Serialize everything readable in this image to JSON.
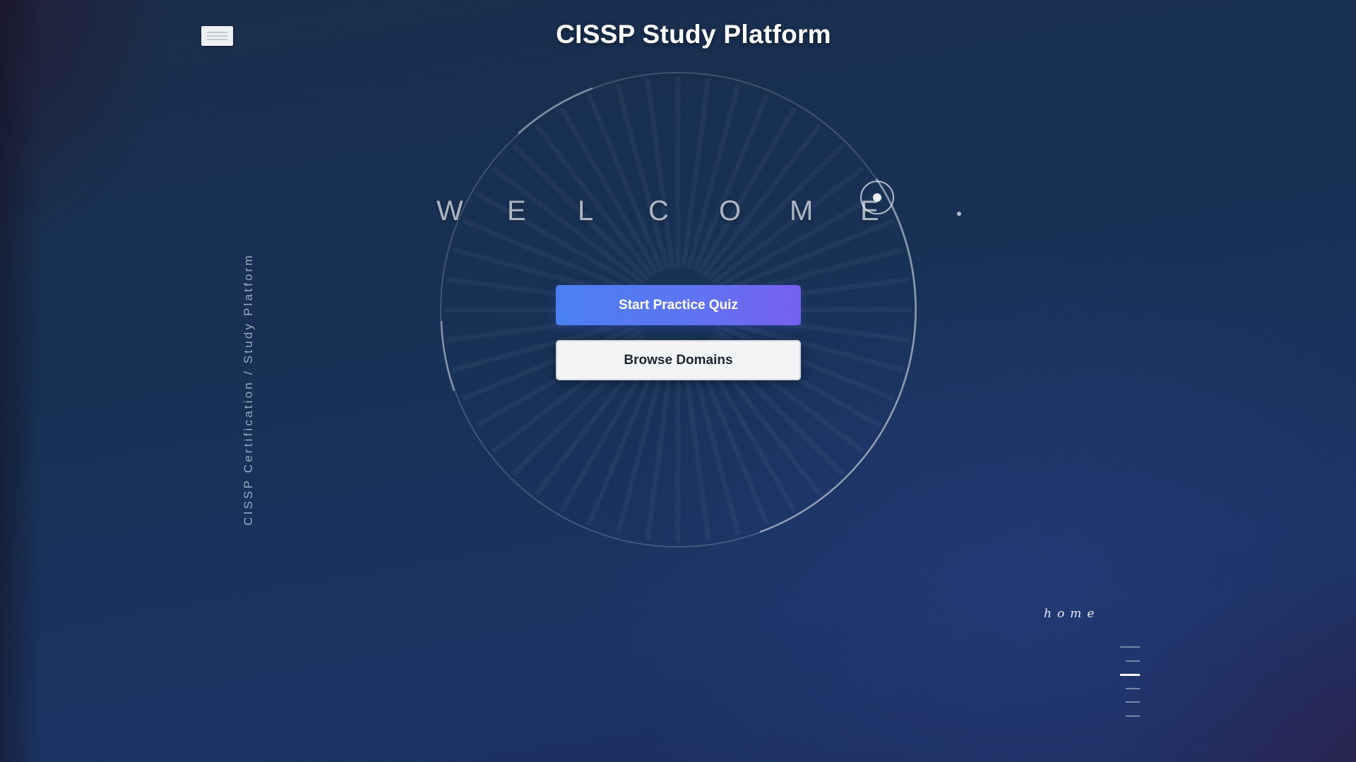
{
  "header": {
    "title": "CISSP Study Platform"
  },
  "sidebar": {
    "caption": "CISSP Certification / Study Platform"
  },
  "hero": {
    "welcome_letters": [
      "W",
      "E",
      "L",
      "C",
      "O",
      "M",
      "E"
    ],
    "primary_button": "Start Practice Quiz",
    "secondary_button": "Browse Domains"
  },
  "section_indicator": {
    "current_label": "home",
    "section_count": 6,
    "active_index": 2
  },
  "colors": {
    "primary_gradient_start": "#4a80f2",
    "primary_gradient_end": "#7660f0",
    "secondary_button_bg": "#f3f4f6",
    "background_dark": "#173256"
  }
}
